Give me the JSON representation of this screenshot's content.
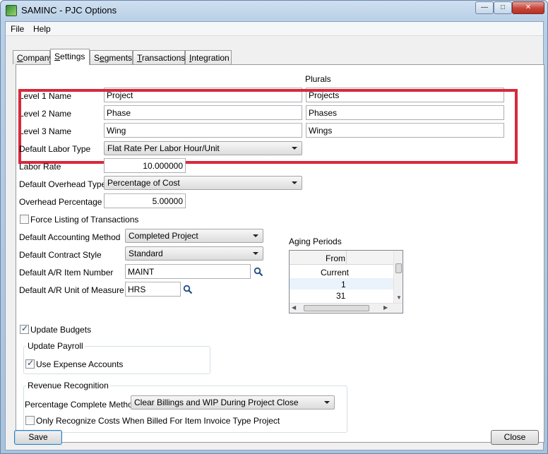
{
  "window": {
    "title": "SAMINC - PJC Options"
  },
  "menu": {
    "file": "File",
    "help": "Help"
  },
  "tabs": [
    {
      "label": "Company",
      "key": "C"
    },
    {
      "label": "Settings",
      "key": "S"
    },
    {
      "label": "Segments",
      "key": "e"
    },
    {
      "label": "Transactions",
      "key": "T"
    },
    {
      "label": "Integration",
      "key": "I"
    }
  ],
  "levels": {
    "plurals_header": "Plurals",
    "rows": [
      {
        "label": "Level 1 Name",
        "name": "Project",
        "plural": "Projects"
      },
      {
        "label": "Level 2 Name",
        "name": "Phase",
        "plural": "Phases"
      },
      {
        "label": "Level 3 Name",
        "name": "Wing",
        "plural": "Wings"
      }
    ]
  },
  "settings": {
    "labor_type_label": "Default Labor Type",
    "labor_type_value": "Flat Rate Per Labor Hour/Unit",
    "labor_rate_label": "Labor Rate",
    "labor_rate_value": "10.000000",
    "overhead_type_label": "Default Overhead Type",
    "overhead_type_value": "Percentage of Cost",
    "overhead_pct_label": "Overhead Percentage",
    "overhead_pct_value": "5.00000",
    "force_listing_label": "Force Listing of Transactions",
    "accounting_method_label": "Default Accounting Method",
    "accounting_method_value": "Completed Project",
    "contract_style_label": "Default Contract Style",
    "contract_style_value": "Standard",
    "ar_item_label": "Default A/R Item Number",
    "ar_item_value": "MAINT",
    "ar_uom_label": "Default A/R Unit of Measure",
    "ar_uom_value": "HRS",
    "update_budgets_label": "Update Budgets"
  },
  "aging": {
    "title": "Aging Periods",
    "header": "From",
    "rows": [
      "Current",
      "1",
      "31"
    ]
  },
  "payroll": {
    "title": "Update Payroll",
    "use_expense_label": "Use Expense Accounts"
  },
  "revenue": {
    "title": "Revenue Recognition",
    "pct_method_label": "Percentage Complete Method",
    "pct_method_value": "Clear Billings and WIP During Project Close",
    "only_recognize_label": "Only Recognize Costs When Billed For Item Invoice Type Project"
  },
  "buttons": {
    "save": "Save",
    "close": "Close"
  },
  "checkboxes": {
    "force_listing": false,
    "update_budgets": true,
    "use_expense": true,
    "only_recognize": false
  },
  "colors": {
    "highlight": "#d7293b"
  },
  "icons": {
    "lookup": "magnifier-icon"
  }
}
